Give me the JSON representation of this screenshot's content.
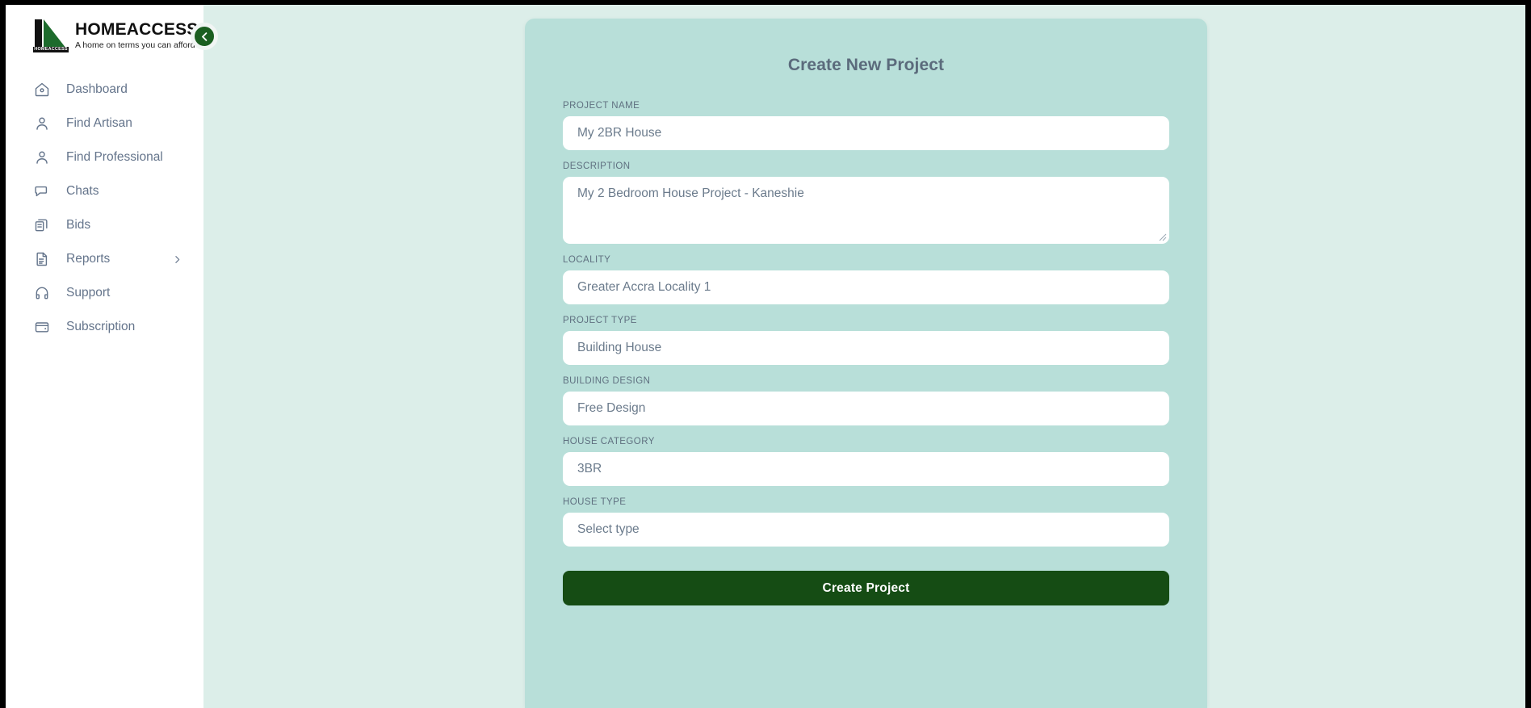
{
  "brand": {
    "name": "HOMEACCESS",
    "tagline": "A home on terms you can afford",
    "logo_base_text": "HOMEACCESS",
    "accent_green": "#1b5e20",
    "logo_triangle_green": "#1d6b2c"
  },
  "sidebar": {
    "collapse_button_label": "",
    "items": [
      {
        "label": "Dashboard",
        "icon": "home-icon",
        "has_chevron": false
      },
      {
        "label": "Find Artisan",
        "icon": "user-icon",
        "has_chevron": false
      },
      {
        "label": "Find Professional",
        "icon": "user-icon",
        "has_chevron": false
      },
      {
        "label": "Chats",
        "icon": "chat-bubble-icon",
        "has_chevron": false
      },
      {
        "label": "Bids",
        "icon": "copy-documents-icon",
        "has_chevron": false
      },
      {
        "label": "Reports",
        "icon": "document-icon",
        "has_chevron": true
      },
      {
        "label": "Support",
        "icon": "headset-icon",
        "has_chevron": false
      },
      {
        "label": "Subscription",
        "icon": "wallet-icon",
        "has_chevron": false
      }
    ]
  },
  "card": {
    "title": "Create New Project",
    "background_color": "#b8dfd9",
    "fields": [
      {
        "label": "PROJECT NAME",
        "value": "My 2BR House",
        "type": "text"
      },
      {
        "label": "DESCRIPTION",
        "value": "My 2 Bedroom House Project - Kaneshie",
        "type": "textarea"
      },
      {
        "label": "LOCALITY",
        "value": "Greater Accra Locality 1",
        "type": "select"
      },
      {
        "label": "PROJECT TYPE",
        "value": "Building House",
        "type": "select"
      },
      {
        "label": "BUILDING DESIGN",
        "value": "Free Design",
        "type": "select"
      },
      {
        "label": "HOUSE CATEGORY",
        "value": "3BR",
        "type": "select"
      },
      {
        "label": "HOUSE TYPE",
        "value": "Select type",
        "type": "select"
      }
    ],
    "submit_label": "Create Project",
    "submit_color": "#154c14"
  },
  "page": {
    "background_color": "#dceee9"
  }
}
